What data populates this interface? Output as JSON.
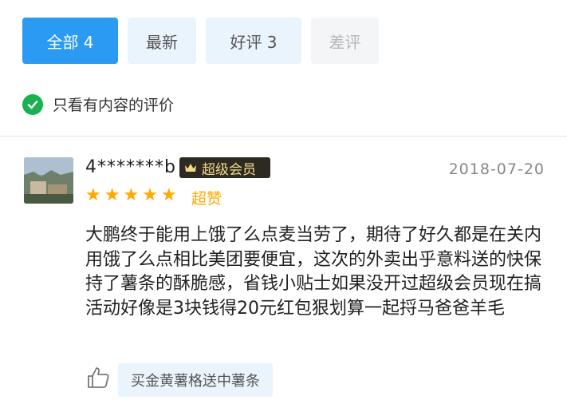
{
  "tabs": [
    {
      "label": "全部 4",
      "state": "active"
    },
    {
      "label": "最新",
      "state": "normal"
    },
    {
      "label": "好评 3",
      "state": "normal"
    },
    {
      "label": "差评",
      "state": "disabled"
    }
  ],
  "filter": {
    "label": "只看有内容的评价",
    "checked": true,
    "icon": "check-circle-icon",
    "color": "#1ab152"
  },
  "review": {
    "username": "4*******b",
    "badge": "超级会员",
    "date": "2018-07-20",
    "stars": 5,
    "rating_text": "超赞",
    "content": "大鹏终于能用上饿了么点麦当劳了，期待了好久都是在关内用饿了么点相比美团要便宜，这次的外卖出乎意料送的快保持了薯条的酥脆感，省钱小贴士如果没开过超级会员现在搞活动好像是3块钱得20元红包狠划算一起捋马爸爸羊毛",
    "liked_item": "买金黄薯格送中薯条"
  },
  "colors": {
    "accent": "#2a9af3",
    "star": "#ffa800",
    "badge_bg": "#2d2a22",
    "badge_text": "#f5d98a"
  }
}
